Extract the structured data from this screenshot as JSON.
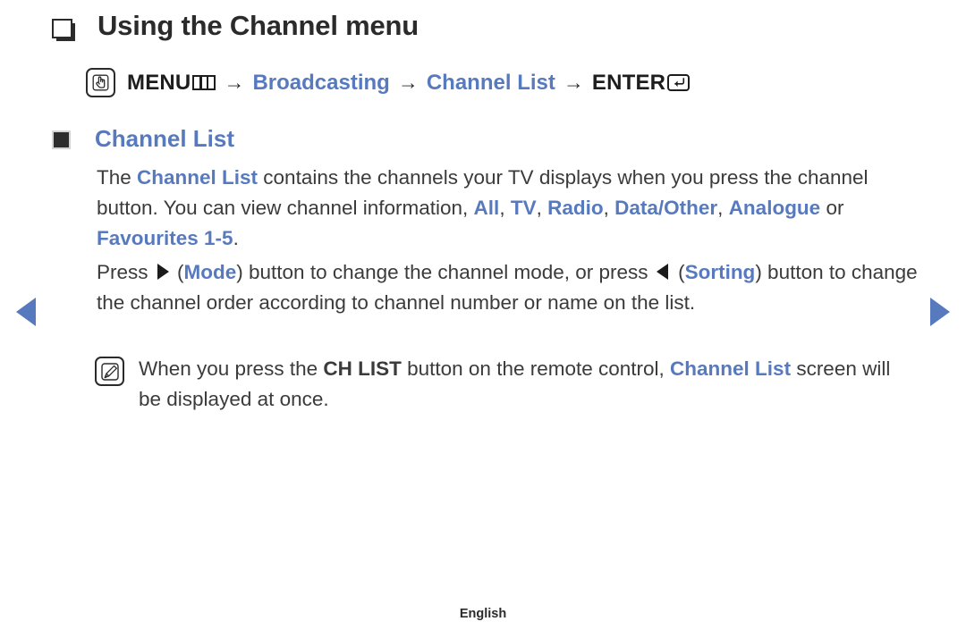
{
  "page": {
    "title": "Using the Channel menu",
    "title_bullet_icon": "hollow-square-bullet-icon",
    "footer_language": "English"
  },
  "nav": {
    "prev_icon": "left-triangle-arrow-icon",
    "next_icon": "right-triangle-arrow-icon"
  },
  "menu_path": {
    "icon": "hand-press-button-icon",
    "menu_label": "MENU",
    "menu_glyph_icon": "menu-bars-icon",
    "arrow": "→",
    "step_broadcasting": "Broadcasting",
    "step_channel_list": "Channel List",
    "enter_label": "ENTER",
    "enter_glyph_icon": "enter-return-key-icon"
  },
  "section": {
    "bullet_icon": "solid-square-bullet-icon",
    "heading": "Channel List"
  },
  "paragraph1": {
    "t1": "The ",
    "link_channel_list": "Channel List",
    "t2": " contains the channels your TV displays when you press the channel button. You can view channel information, ",
    "opt_all": "All",
    "sep1": ", ",
    "opt_tv": "TV",
    "sep2": ", ",
    "opt_radio": "Radio",
    "sep3": ", ",
    "opt_data_other": "Data/Other",
    "sep4": ", ",
    "opt_analogue": "Analogue",
    "t3": " or ",
    "opt_favourites": "Favourites 1-5",
    "t4": "."
  },
  "paragraph2": {
    "t1": "Press ",
    "right_triangle_icon": "right-direction-button-icon",
    "t2": " (",
    "label_mode": "Mode",
    "t3": ") button to change the channel mode, or press ",
    "left_triangle_icon": "left-direction-button-icon",
    "t4": " (",
    "label_sorting": "Sorting",
    "t5": ") button to change the channel order according to channel number or name on the list."
  },
  "note": {
    "icon": "note-pencil-icon",
    "t1": "When you press the ",
    "key_ch_list": "CH LIST",
    "t2": " button on the remote control, ",
    "link_channel_list": "Channel List",
    "t3": " screen will be displayed at once."
  },
  "colors": {
    "accent_blue": "#577abf",
    "text_dark": "#3b3b3b",
    "title_dark": "#2b2b2b",
    "background": "#ffffff"
  }
}
